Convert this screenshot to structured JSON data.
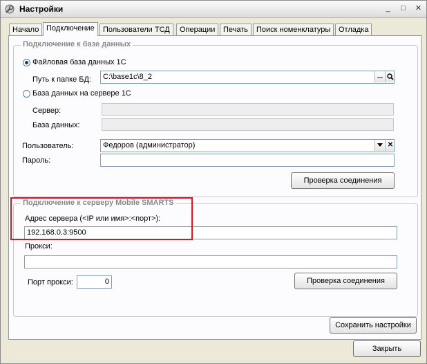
{
  "window": {
    "title": "Настройки",
    "minimize": "_",
    "maximize": "□",
    "close": "✕"
  },
  "tabs": [
    "Начало",
    "Подключение",
    "Пользователи ТСД",
    "Операции",
    "Печать",
    "Поиск номенклатуры",
    "Отладка"
  ],
  "db_group": {
    "title": "Подключение к базе данных",
    "file_db_label": "Файловая база данных 1С",
    "path_label": "Путь к папке БД:",
    "path_value": "C:\\base1c\\8_2",
    "browse_glyph": "...",
    "server_db_label": "База данных на сервере 1С",
    "server_label": "Сервер:",
    "database_label": "База данных:",
    "user_label": "Пользователь:",
    "user_value": "Федоров (администратор)",
    "password_label": "Пароль:",
    "check_button": "Проверка соединения"
  },
  "mobile_group": {
    "title": "Подключение к серверу Mobile SMARTS",
    "address_label": "Адрес сервера (<IP или имя>:<порт>):",
    "address_value": "192.168.0.3:9500",
    "proxy_label": "Прокси:",
    "proxy_value": "",
    "proxy_port_label": "Порт прокси:",
    "proxy_port_value": "0",
    "check_button": "Проверка соединения"
  },
  "save_button": "Сохранить настройки",
  "close_button": "Закрыть",
  "colors": {
    "highlight": "#e0141c",
    "window_bg": "#ece9d8"
  }
}
